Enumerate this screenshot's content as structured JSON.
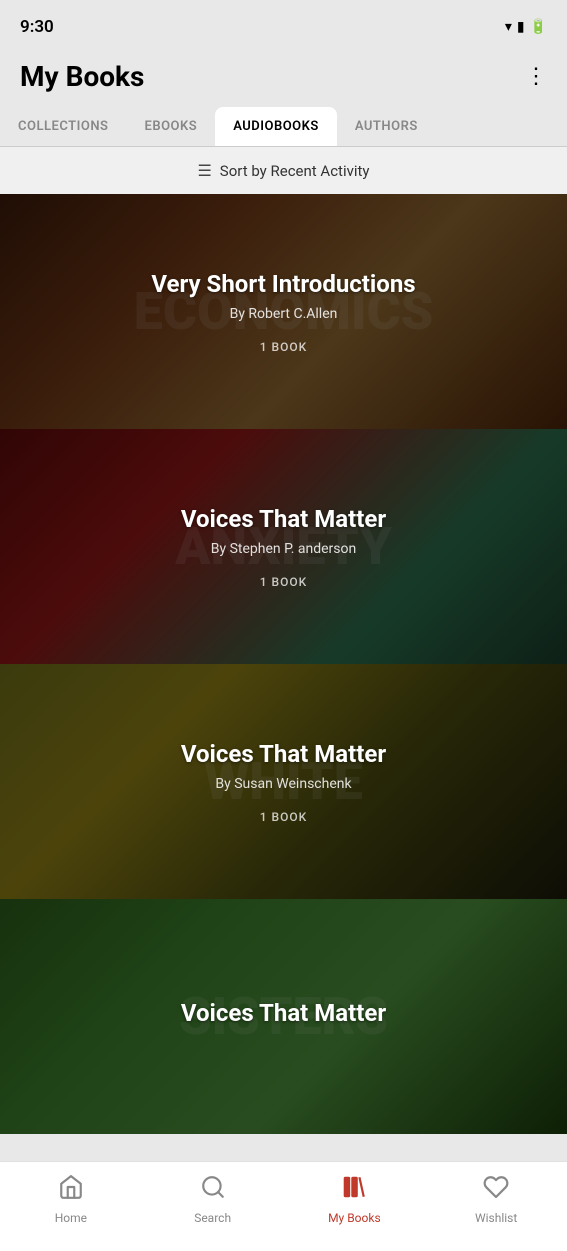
{
  "statusBar": {
    "time": "9:30"
  },
  "header": {
    "title": "My Books",
    "menuLabel": "⋮"
  },
  "tabs": [
    {
      "id": "collections",
      "label": "COLLECTIONS",
      "active": false
    },
    {
      "id": "ebooks",
      "label": "EBOOKS",
      "active": false
    },
    {
      "id": "audiobooks",
      "label": "AUDIOBOOKS",
      "active": true
    },
    {
      "id": "authors",
      "label": "AUTHORS",
      "active": false
    }
  ],
  "sortBar": {
    "text": "Sort by Recent Activity"
  },
  "books": [
    {
      "id": "book-1",
      "title": "Very Short Introductions",
      "author": "By Robert C.Allen",
      "count": "1 BOOK",
      "bgClass": "card-bg-1",
      "bgText": "ECONOMICS"
    },
    {
      "id": "book-2",
      "title": "Voices That Matter",
      "author": "By Stephen P. anderson",
      "count": "1 BOOK",
      "bgClass": "card-bg-2",
      "bgText": "ANXIETY"
    },
    {
      "id": "book-3",
      "title": "Voices That Matter",
      "author": "By Susan Weinschenk",
      "count": "1 BOOK",
      "bgClass": "card-bg-3",
      "bgText": "WHITE"
    },
    {
      "id": "book-4",
      "title": "Voices That Matter",
      "author": "",
      "count": "",
      "bgClass": "card-bg-4",
      "bgText": "SISTERS"
    }
  ],
  "bottomNav": [
    {
      "id": "home",
      "label": "Home",
      "icon": "home",
      "active": false
    },
    {
      "id": "search",
      "label": "Search",
      "icon": "search",
      "active": false
    },
    {
      "id": "mybooks",
      "label": "My Books",
      "icon": "books",
      "active": true
    },
    {
      "id": "wishlist",
      "label": "Wishlist",
      "icon": "heart",
      "active": false
    }
  ]
}
